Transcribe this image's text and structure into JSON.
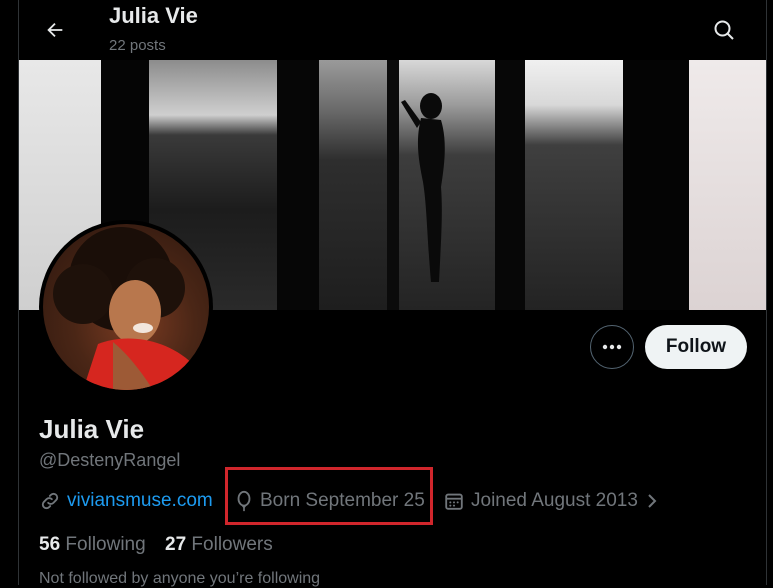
{
  "header": {
    "name": "Julia Vie",
    "posts": "22 posts"
  },
  "profile": {
    "name": "Julia Vie",
    "handle": "@DestenyRangel",
    "website": "viviansmuse.com",
    "birthday": "Born September 25",
    "joined": "Joined August 2013",
    "following_count": "56",
    "following_label": "Following",
    "followers_count": "27",
    "followers_label": "Followers",
    "not_followed_text": "Not followed by anyone you’re following"
  },
  "actions": {
    "follow_label": "Follow"
  },
  "icons": {
    "back": "arrow-left-icon",
    "search": "search-icon",
    "more": "more-dots-icon",
    "link": "link-icon",
    "balloon": "balloon-icon",
    "calendar": "calendar-icon",
    "chevron": "chevron-right-icon"
  },
  "colors": {
    "background": "#000000",
    "link": "#1d9bf0",
    "highlight": "#d0262c",
    "follow_button": "#eff3f4"
  }
}
